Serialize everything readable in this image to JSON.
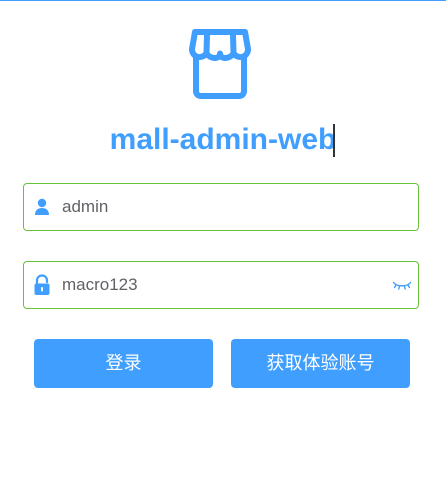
{
  "app": {
    "title": "mall-admin-web"
  },
  "login_form": {
    "username": {
      "value": "admin",
      "icon": "user-icon"
    },
    "password": {
      "value": "macro123",
      "icon": "lock-icon",
      "toggle_icon": "eye-closed-icon"
    }
  },
  "buttons": {
    "login_label": "登录",
    "trial_label": "获取体验账号"
  },
  "colors": {
    "primary": "#409eff",
    "field_border": "#67c23a",
    "text": "#606266"
  }
}
